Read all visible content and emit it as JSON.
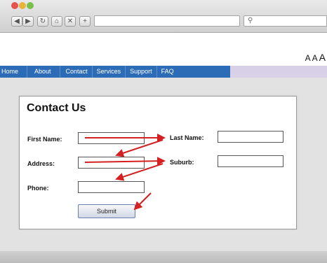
{
  "browser": {
    "nav_buttons": [
      {
        "icon": "back-arrow-icon",
        "glyph": "◀"
      },
      {
        "icon": "forward-arrow-icon",
        "glyph": "▶"
      },
      {
        "icon": "reload-icon",
        "glyph": "↻"
      },
      {
        "icon": "home-icon",
        "glyph": "⌂"
      },
      {
        "icon": "close-icon",
        "glyph": "✕"
      },
      {
        "icon": "new-tab-icon",
        "glyph": "+"
      }
    ],
    "search_glyph": "⚲"
  },
  "page": {
    "font_controls": [
      "A",
      "A",
      "A"
    ],
    "menu": [
      "Home",
      "About",
      "Contact",
      "Services",
      "Support",
      "FAQ"
    ],
    "form": {
      "title": "Contact Us",
      "first_name_label": "First Name:",
      "last_name_label": "Last Name:",
      "address_label": "Address:",
      "suburb_label": "Suburb:",
      "phone_label": "Phone:",
      "first_name_value": "",
      "last_name_value": "",
      "address_value": "",
      "suburb_value": "",
      "phone_value": "",
      "submit_label": "Submit"
    }
  },
  "colors": {
    "menu_bg": "#2c6cb6",
    "arrow": "#d42020"
  }
}
